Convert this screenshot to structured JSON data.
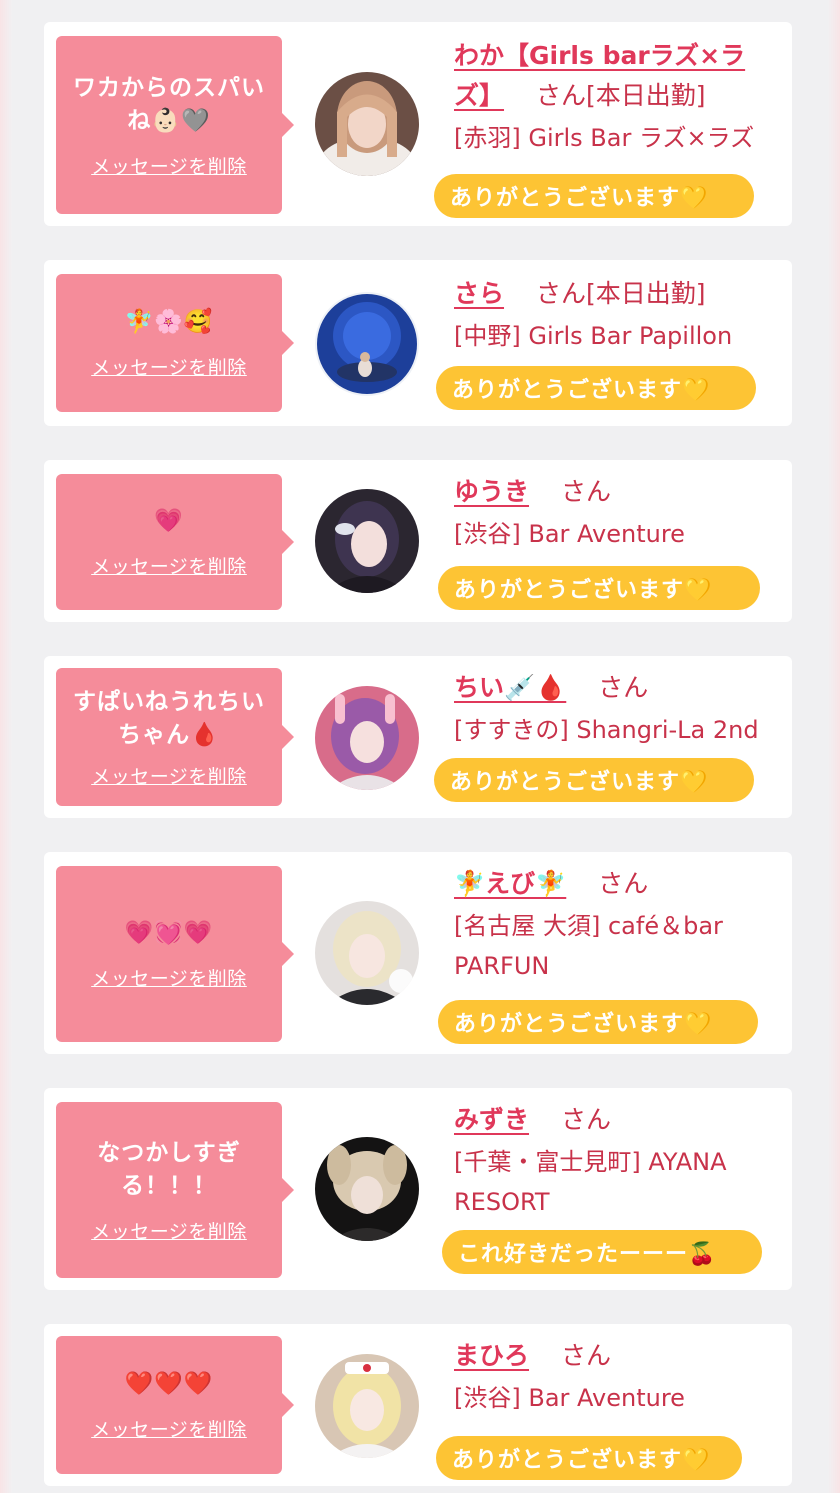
{
  "delete_label": "メッセージを削除",
  "san_label": "さん",
  "items": [
    {
      "message": "ワカからのスパいね👶🏻🩶",
      "name": "わか【Girls barラズ×ラズ】",
      "tag": "[本日出勤]",
      "shop": "[赤羽] Girls Bar ラズ×ラズ",
      "reply": "ありがとうございます💛"
    },
    {
      "message": "🧚🌸🥰",
      "name": "さら",
      "tag": "[本日出勤]",
      "shop": "[中野] Girls Bar Papillon",
      "reply": "ありがとうございます💛"
    },
    {
      "message": "💗",
      "name": "ゆうき",
      "tag": "",
      "shop": "[渋谷] Bar Aventure",
      "reply": "ありがとうございます💛"
    },
    {
      "message": "すぱいねうれちいちゃん🩸",
      "name": "ちい💉🩸",
      "tag": "",
      "shop": "[すすきの] Shangri-La 2nd",
      "reply": "ありがとうございます💛"
    },
    {
      "message": "💗💓💗",
      "name": "🧚えび🧚",
      "tag": "",
      "shop": "[名古屋 大須] café＆bar PARFUN",
      "reply": "ありがとうございます💛"
    },
    {
      "message": "なつかしすぎる！！！",
      "name": "みずき",
      "tag": "",
      "shop": "[千葉・富士見町] AYANA RESORT",
      "reply": "これ好きだったーーー🍒"
    },
    {
      "message": "❤️❤️❤️",
      "name": "まひろ",
      "tag": "",
      "shop": "[渋谷] Bar Aventure",
      "reply": "ありがとうございます💛"
    }
  ]
}
